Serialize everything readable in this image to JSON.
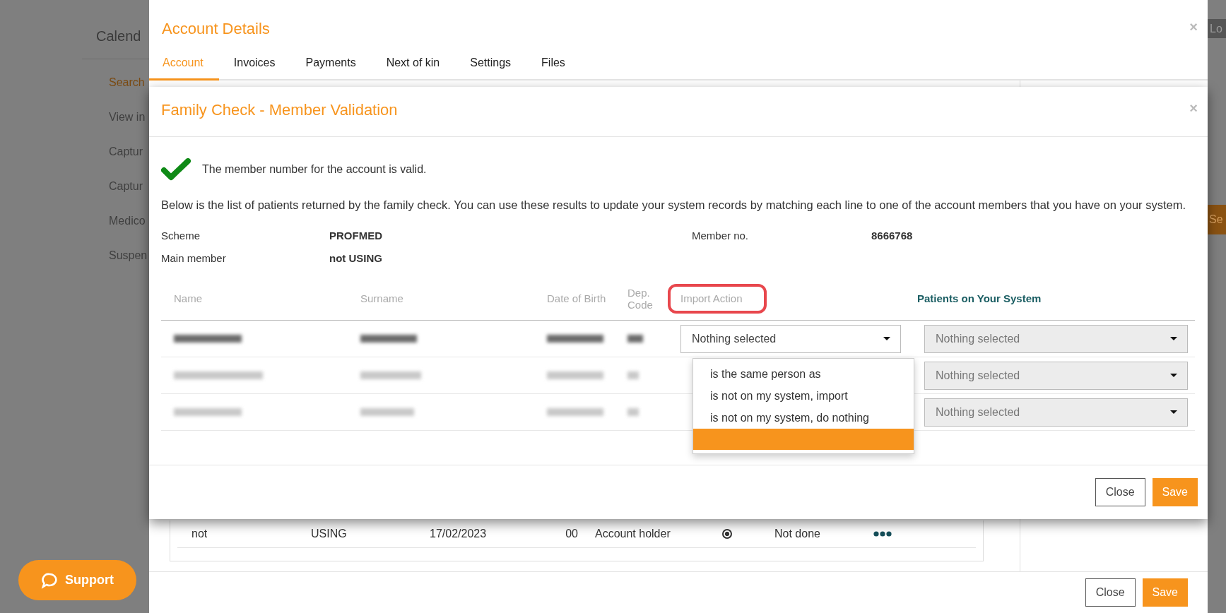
{
  "background": {
    "nav_title": "Calend",
    "nav_items": [
      {
        "label": "Search",
        "selected": true
      },
      {
        "label": "View in",
        "selected": false
      },
      {
        "label": "Captur",
        "selected": false
      },
      {
        "label": "Captur",
        "selected": false
      },
      {
        "label": "Medico",
        "selected": false
      },
      {
        "label": "Suspen",
        "selected": false
      }
    ],
    "top_button": "Lo",
    "search_button": "Se"
  },
  "support_button": "Support",
  "account_modal": {
    "title": "Account Details",
    "close": "×",
    "tabs": [
      {
        "label": "Account",
        "selected": true
      },
      {
        "label": "Invoices",
        "selected": false
      },
      {
        "label": "Payments",
        "selected": false
      },
      {
        "label": "Next of kin",
        "selected": false
      },
      {
        "label": "Settings",
        "selected": false
      },
      {
        "label": "Files",
        "selected": false
      }
    ],
    "member_row": {
      "name": "not",
      "surname": "USING",
      "date": "17/02/2023",
      "code": "00",
      "role": "Account holder",
      "radio_checked": true,
      "status": "Not done"
    },
    "buttons": [
      "Close",
      "Save"
    ]
  },
  "family_modal": {
    "title": "Family Check - Member Validation",
    "close": "×",
    "valid_message": "The member number for the account is valid.",
    "intro": "Below is the list of patients returned by the family check. You can use these results to update your system records by matching each line to one of the account members that you have on your system.",
    "scheme_label": "Scheme",
    "scheme": "PROFMED",
    "main_member_label": "Main member",
    "main_member": "not USING",
    "member_no_label": "Member no.",
    "member_no": "8666768",
    "columns": [
      {
        "label": "Name",
        "annotated": false,
        "emphasized": false
      },
      {
        "label": "Surname",
        "annotated": false,
        "emphasized": false
      },
      {
        "label": "Date of Birth",
        "annotated": false,
        "emphasized": false
      },
      {
        "label": "Dep. Code",
        "annotated": false,
        "emphasized": false
      },
      {
        "label": "Import Action",
        "annotated": true,
        "emphasized": false
      },
      {
        "label": "Patients on Your System",
        "annotated": false,
        "emphasized": true
      }
    ],
    "rows": [
      {
        "bold": true,
        "import_action": "Nothing selected",
        "patient": "Nothing selected"
      },
      {
        "bold": false,
        "patient": "Nothing selected"
      },
      {
        "bold": false,
        "patient": "Nothing selected"
      }
    ],
    "import_options": [
      {
        "label": "is the same person as",
        "selected": false
      },
      {
        "label": "is not on my system, import",
        "selected": false
      },
      {
        "label": "is not on my system, do nothing",
        "selected": false
      }
    ],
    "blank_option_highlighted": true,
    "buttons": [
      "Close",
      "Save"
    ]
  }
}
